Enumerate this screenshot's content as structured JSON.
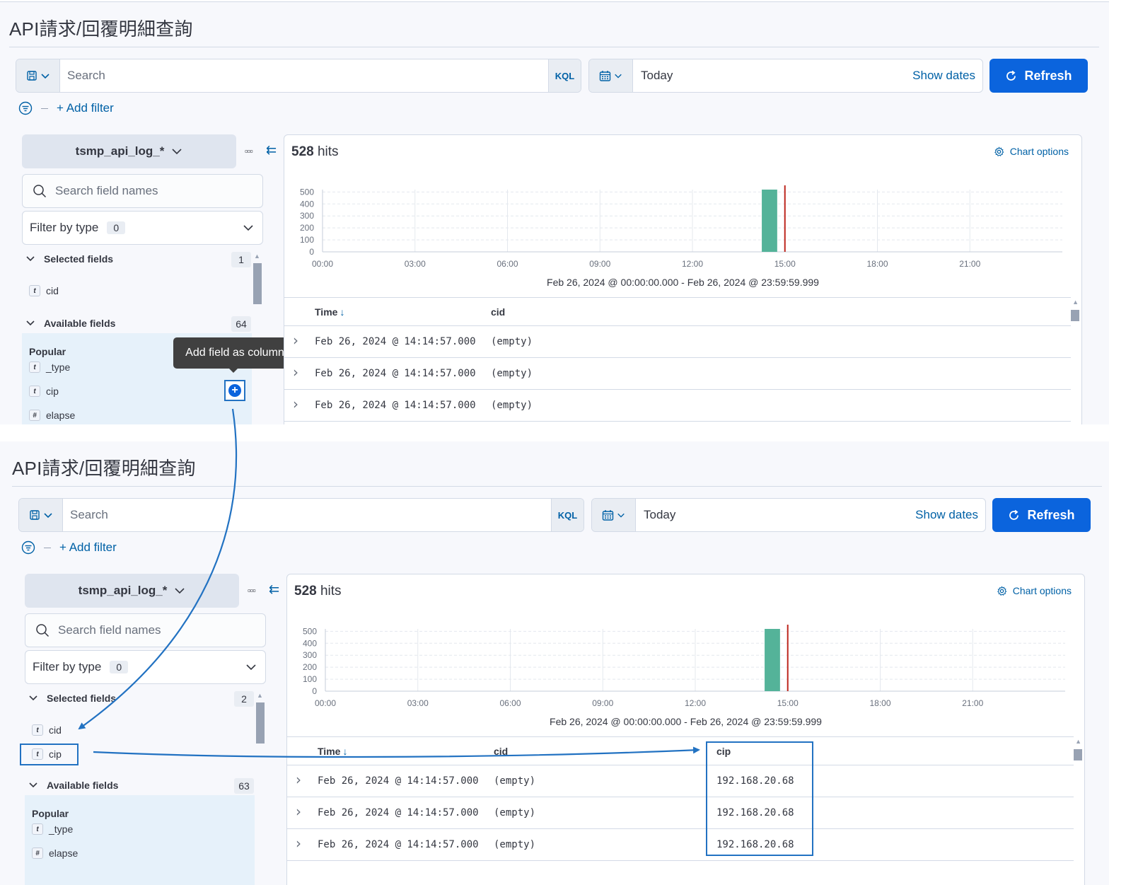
{
  "page": {
    "title": "API請求/回覆明細查詢"
  },
  "query": {
    "placeholder": "Search",
    "language": "KQL"
  },
  "date": {
    "value": "Today",
    "show_dates": "Show dates"
  },
  "refresh_label": "Refresh",
  "add_filter_label": "+ Add filter",
  "index_pattern": "tsmp_api_log_*",
  "field_search_placeholder": "Search field names",
  "filter_by_type": {
    "label": "Filter by type",
    "count": "0"
  },
  "sidebar_labels": {
    "selected": "Selected fields",
    "available": "Available fields",
    "popular": "Popular"
  },
  "tooltip": "Add field as column",
  "hits": {
    "count": "528",
    "label": "hits"
  },
  "chart_options_label": "Chart options",
  "chart_data": {
    "type": "bar",
    "x_ticks": [
      "00:00",
      "03:00",
      "06:00",
      "09:00",
      "12:00",
      "15:00",
      "18:00",
      "21:00"
    ],
    "y_ticks": [
      500,
      400,
      300,
      200,
      100,
      0
    ],
    "ylim": [
      0,
      520
    ],
    "bars": [
      {
        "x_hour": 14.25,
        "value": 528
      }
    ],
    "now_marker_hour": 15,
    "bar_color": "#54b399",
    "marker_color": "#bd271e",
    "grid": true,
    "range_label": "Feb 26, 2024 @ 00:00:00.000 - Feb 26, 2024 @ 23:59:59.999"
  },
  "before": {
    "selected_fields": [
      {
        "type": "t",
        "name": "cid"
      }
    ],
    "selected_count": "1",
    "available_count": "64",
    "popular_fields": [
      {
        "type": "t",
        "name": "_type"
      },
      {
        "type": "t",
        "name": "cip"
      },
      {
        "type": "#",
        "name": "elapse"
      }
    ],
    "columns": [
      "Time",
      "cid"
    ],
    "rows": [
      [
        "Feb 26, 2024 @ 14:14:57.000",
        "(empty)"
      ],
      [
        "Feb 26, 2024 @ 14:14:57.000",
        "(empty)"
      ],
      [
        "Feb 26, 2024 @ 14:14:57.000",
        "(empty)"
      ]
    ]
  },
  "after": {
    "selected_fields": [
      {
        "type": "t",
        "name": "cid"
      },
      {
        "type": "t",
        "name": "cip"
      }
    ],
    "selected_count": "2",
    "available_count": "63",
    "popular_fields": [
      {
        "type": "t",
        "name": "_type"
      },
      {
        "type": "#",
        "name": "elapse"
      }
    ],
    "columns": [
      "Time",
      "cid",
      "cip"
    ],
    "rows": [
      [
        "Feb 26, 2024 @ 14:14:57.000",
        "(empty)",
        "192.168.20.68"
      ],
      [
        "Feb 26, 2024 @ 14:14:57.000",
        "(empty)",
        "192.168.20.68"
      ],
      [
        "Feb 26, 2024 @ 14:14:57.000",
        "(empty)",
        "192.168.20.68"
      ]
    ]
  }
}
